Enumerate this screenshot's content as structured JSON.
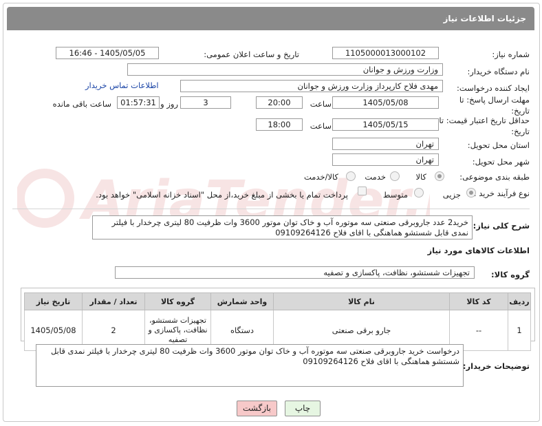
{
  "header": {
    "title": "جزئیات اطلاعات نیاز"
  },
  "form": {
    "need_number_label": "شماره نیاز:",
    "need_number": "1105000013000102",
    "announce_label": "تاریخ و ساعت اعلان عمومی:",
    "announce_value": "1405/05/05 - 16:46",
    "buyer_org_label": "نام دستگاه خریدار:",
    "buyer_org": "وزارت ورزش و جوانان",
    "creator_label": "ایجاد کننده درخواست:",
    "creator": "مهدی فلاح کارپرداز وزارت ورزش و جوانان",
    "contact_link": "اطلاعات تماس خریدار",
    "deadline_label": "مهلت ارسال پاسخ: تا تاریخ:",
    "deadline_date": "1405/05/08",
    "time_label": "ساعت",
    "deadline_time": "20:00",
    "days_value": "3",
    "days_label": "روز و",
    "remaining_time": "01:57:31",
    "remaining_label": "ساعت باقی مانده",
    "price_validity_label": "حداقل تاریخ اعتبار قیمت: تا تاریخ:",
    "price_validity_date": "1405/05/15",
    "price_validity_time": "18:00",
    "province_label": "استان محل تحویل:",
    "province": "تهران",
    "city_label": "شهر محل تحویل:",
    "city": "تهران",
    "category_label": "طبقه بندی موضوعی:",
    "category_options": [
      "کالا",
      "خدمت",
      "کالا/خدمت"
    ],
    "process_label": "نوع فرآیند خرید :",
    "process_options": [
      "جزیی",
      "متوسط"
    ],
    "payment_note": "پرداخت تمام یا بخشی از مبلغ خرید،از محل \"اسناد خزانه اسلامی\" خواهد بود."
  },
  "general_desc": {
    "label": "شرح کلی نیاز:",
    "text": "خرید2 عدد جاروبرقی صنعتی سه موتوره آب و خاک توان موتور 3600 وات  ظرفیت 80 لیتری  چرخدار با فیلتر نمدی قابل شستشو  هماهنگی با اقای فلاح 09109264126"
  },
  "goods_info": {
    "title": "اطلاعات کالاهای مورد نیاز",
    "group_label": "گروه کالا:",
    "group_value": "تجهیزات شستشو، نظافت، پاکسازی و تصفیه"
  },
  "table": {
    "headers": [
      "ردیف",
      "کد کالا",
      "نام کالا",
      "واحد شمارش",
      "گروه کالا",
      "تعداد / مقدار",
      "تاریخ نیاز"
    ],
    "rows": [
      [
        "1",
        "--",
        "جارو برقی صنعتی",
        "دستگاه",
        "تجهیزات شستشو، نظافت، پاکسازی و تصفیه",
        "2",
        "1405/05/08"
      ]
    ]
  },
  "buyer_notes": {
    "label": "توضیحات خریدار:",
    "text": "درخواست خرید جاروبرقی صنعتی سه موتوره آب و خاک توان موتور 3600 وات  ظرفیت 80 لیتری  چرخدار با فیلتر نمدی قابل شستشو  هماهنگی با اقای فلاح 09109264126"
  },
  "buttons": {
    "print": "چاپ",
    "back": "بازگشت"
  },
  "watermark": {
    "text": "AriaTender.net"
  },
  "colors": {
    "header_bg": "#8a8a8a",
    "back_button": "#f7c9c9",
    "print_button": "#e6f6e2",
    "link": "#1a44a6"
  }
}
